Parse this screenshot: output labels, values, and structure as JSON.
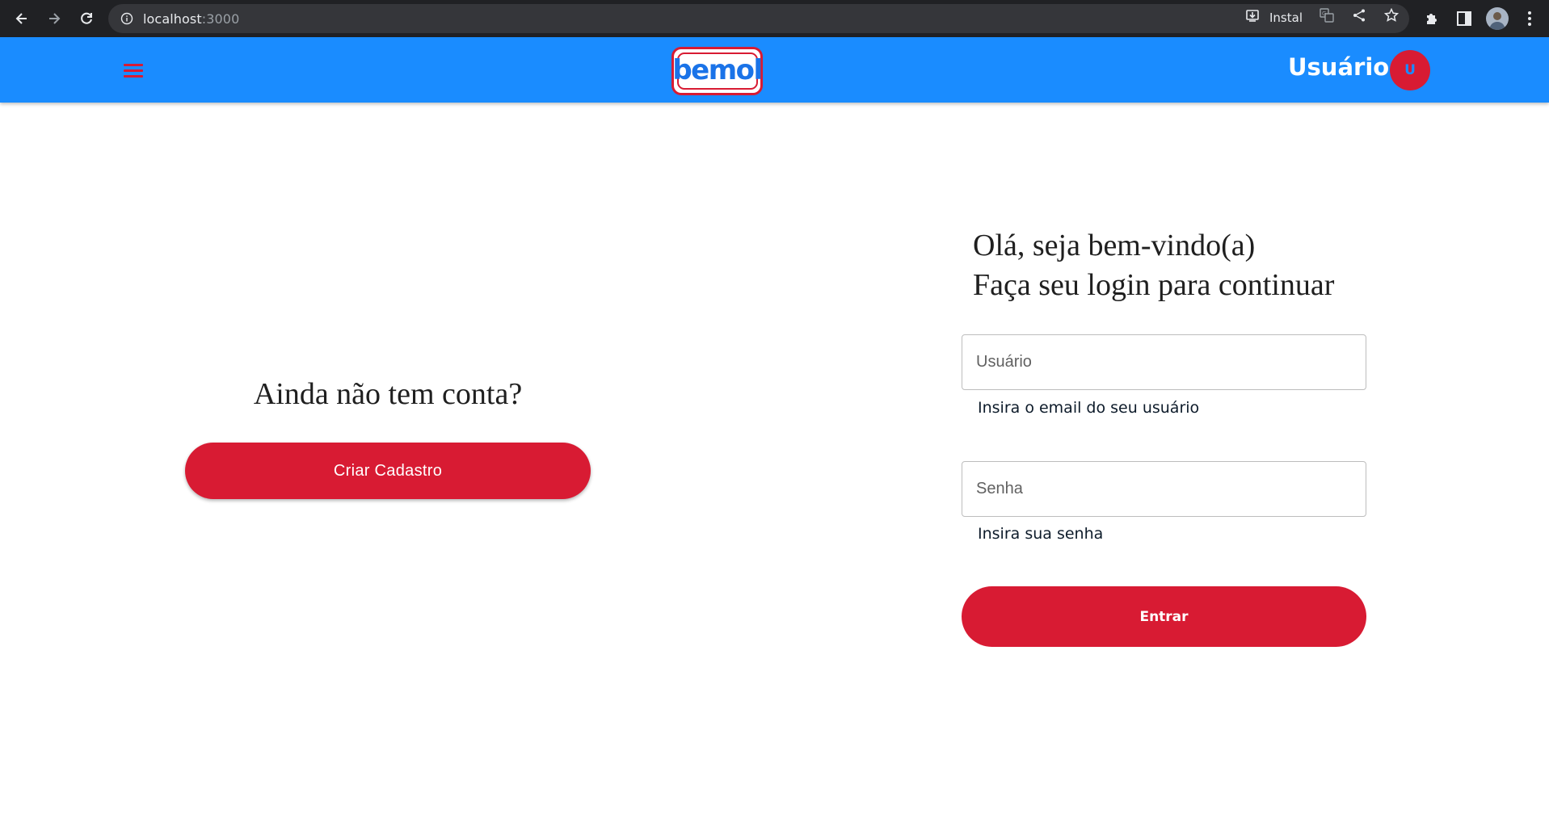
{
  "browser": {
    "url_host": "localhost",
    "url_port": ":3000",
    "install_label": "Instal"
  },
  "header": {
    "logo_text": "bemol",
    "user_label": "Usuário",
    "avatar_initial": "U"
  },
  "signup": {
    "title": "Ainda não tem conta?",
    "button_label": "Criar Cadastro"
  },
  "login": {
    "welcome_line1": "Olá, seja bem-vindo(a)",
    "welcome_line2": "Faça seu login para continuar",
    "username_placeholder": "Usuário",
    "username_helper": "Insira o email do seu usuário",
    "password_placeholder": "Senha",
    "password_helper": "Insira sua senha",
    "submit_label": "Entrar"
  },
  "colors": {
    "header_blue": "#1a8cff",
    "brand_red": "#d81b33",
    "logo_blue": "#1a73e8"
  }
}
